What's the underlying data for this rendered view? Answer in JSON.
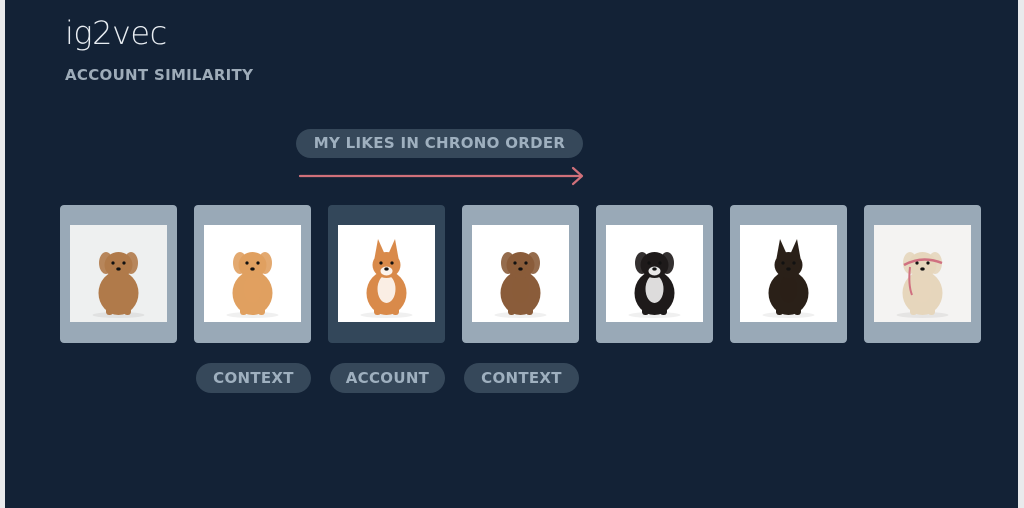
{
  "header": {
    "title": "ig2vec",
    "subtitle": "ACCOUNT SIMILARITY"
  },
  "timeline": {
    "label": "MY LIKES IN CHRONO ORDER",
    "arrow_color": "#d0707a"
  },
  "colors": {
    "background": "#132236",
    "card": "#99a9b7",
    "card_highlight": "#33475a",
    "pill": "#36485a",
    "pill_text": "#9fb0bf"
  },
  "cards": [
    {
      "subject": "toy poodle puppy",
      "role": null,
      "fur": "#b07a4a",
      "bg": "#eef0f0"
    },
    {
      "subject": "pomeranian",
      "role": "CONTEXT",
      "fur": "#e0a060",
      "bg": "#ffffff"
    },
    {
      "subject": "corgi",
      "role": "ACCOUNT",
      "fur": "#d98a4a",
      "bg": "#ffffff"
    },
    {
      "subject": "cockapoo",
      "role": "CONTEXT",
      "fur": "#8a5c3a",
      "bg": "#ffffff"
    },
    {
      "subject": "australian shepherd puppy",
      "role": null,
      "fur": "#1e1a1a",
      "bg": "#ffffff"
    },
    {
      "subject": "german shepherd puppy",
      "role": null,
      "fur": "#2a2018",
      "bg": "#ffffff"
    },
    {
      "subject": "golden retriever with leash",
      "role": null,
      "fur": "#e6d6bc",
      "bg": "#f4f3f2"
    }
  ],
  "labels": [
    "CONTEXT",
    "ACCOUNT",
    "CONTEXT"
  ]
}
